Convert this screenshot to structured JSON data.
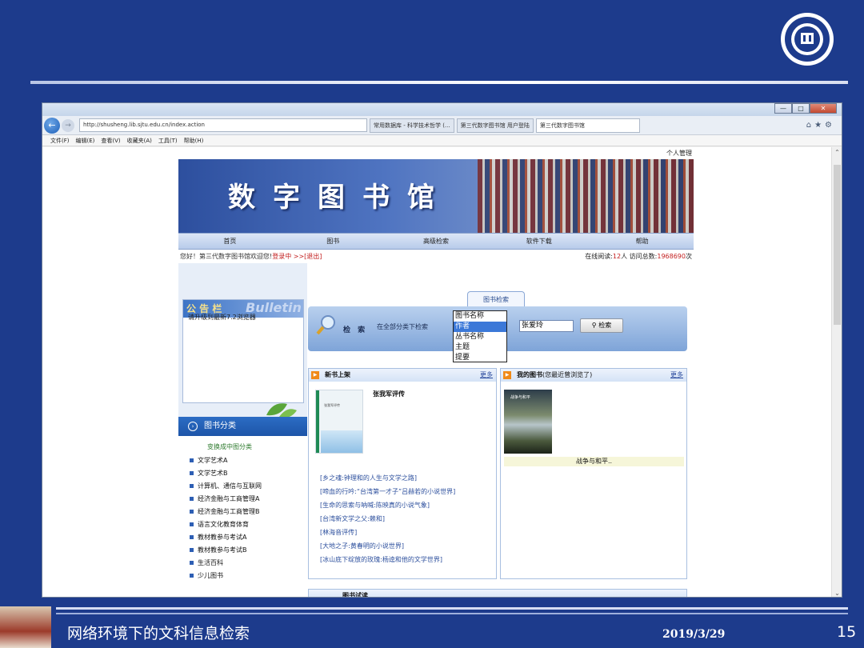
{
  "slide": {
    "footer_title": "网络环境下的文科信息检索",
    "date": "2019/3/29",
    "page_number": "15"
  },
  "browser": {
    "url": "http://shusheng.lib.sjtu.edu.cn/index.action",
    "tabs": [
      {
        "label": "常用数据库 - 科学技术哲学 (..."
      },
      {
        "label": "第三代数字图书馆 用户登陆"
      },
      {
        "label": "第三代数字图书馆"
      }
    ],
    "menu": [
      "文件(F)",
      "编辑(E)",
      "查看(V)",
      "收藏夹(A)",
      "工具(T)",
      "帮助(H)"
    ]
  },
  "site": {
    "personal_link": "个人管理",
    "banner_title": "数字图书馆",
    "nav": [
      "首页",
      "图书",
      "高级检索",
      "软件下载",
      "帮助"
    ],
    "welcome_prefix": "您好！第三代数字图书馆欢迎您!",
    "welcome_status": "登录中 >>[退出]",
    "online_label": "在线阅读:",
    "online_count": "12",
    "online_unit": "人 访问总数:",
    "visit_total": "1968690",
    "visit_unit": "次"
  },
  "bulletin": {
    "title": "公 告 栏",
    "bg_text": "Bulletin",
    "message": "请升级到最新7.2浏览器"
  },
  "categories": {
    "header": "图书分类",
    "switch": "变换成中图分类",
    "items": [
      "文学艺术A",
      "文学艺术B",
      "计算机、通信与互联网",
      "经济金融与工商管理A",
      "经济金融与工商管理B",
      "语言文化教育体育",
      "教材教参与考试A",
      "教材教参与考试B",
      "生活百科",
      "少儿图书"
    ]
  },
  "search": {
    "tab_label": "图书检索",
    "label": "检 索",
    "scope": "在全部分类下检索",
    "options": [
      "图书名称",
      "作者",
      "丛书名称",
      "主题",
      "提要"
    ],
    "selected_index": 1,
    "query": "张爱玲",
    "button": "检索"
  },
  "new_books": {
    "header": "新书上架",
    "more": "更多",
    "cover_text": "张我军评传",
    "featured_title": "张我军评传",
    "links": [
      "[乡之魂:钟理和的人生与文学之路]",
      "[啼血的行吟:“台湾第一才子”吕赫若的小说世界]",
      "[生命的思索与呐喊:陈映真的小说气象]",
      "[台湾新文学之父:赖和]",
      "[林海音评传]",
      "[大地之子:黄春明的小说世界]",
      "[冰山底下绽放的玫瑰:杨逵和他的文学世界]"
    ]
  },
  "my_books": {
    "header": "我的图书",
    "sub": "(您最近曾浏览了)",
    "more": "更多",
    "cover_text": "战争与和平",
    "book_name": "战争与和平.."
  },
  "bottom_panel": {
    "header": "图书试读"
  }
}
